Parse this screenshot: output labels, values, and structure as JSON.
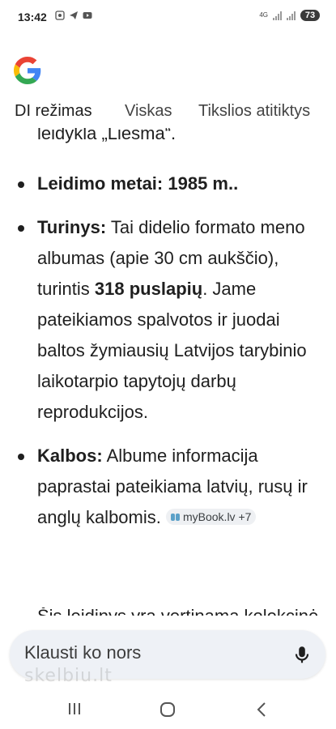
{
  "status_bar": {
    "time": "13:42",
    "network_label": "4G",
    "battery": "73"
  },
  "tabs": [
    {
      "label": "DI režimas",
      "active": true
    },
    {
      "label": "Viskas",
      "active": false
    },
    {
      "label": "Tikslios atitiktys",
      "active": false
    }
  ],
  "content": {
    "partial_top_line": "leidykla „Liesma“.",
    "items": [
      {
        "key": "Leidimo metai:",
        "text": " 1985 m..",
        "key_bold": true
      },
      {
        "key": "Turinys:",
        "segments": [
          {
            "t": " Tai didelio formato meno albumas (apie 30 cm aukščio), turintis ",
            "b": false
          },
          {
            "t": "318 puslapių",
            "b": true
          },
          {
            "t": ". Jame pateikiamos spalvotos ir juodai baltos žymiausių Latvijos tarybinio laikotarpio tapytojų darbų reprodukcijos.",
            "b": false
          }
        ]
      },
      {
        "key": "Kalbos:",
        "text": " Albume informacija paprastai pateikiama latvių, rusų ir anglų kalbomis. ",
        "source_chip": "myBook.lv +7"
      }
    ],
    "partial_bottom_line": "Šis leidinys yra vertinama kolekcinė"
  },
  "ask_bar": {
    "placeholder": "Klausti ko nors"
  },
  "watermark": "skelbiu.lt",
  "colors": {
    "text": "#1f1f1f",
    "ask_bar_bg": "#eef1f6",
    "chip_bg": "#eef0f3",
    "google_blue": "#4285F4",
    "google_red": "#EA4335",
    "google_yellow": "#FBBC05",
    "google_green": "#34A853"
  },
  "icons": {
    "logo": "google-g-logo",
    "mic": "microphone-icon",
    "nav_recent": "recent-apps-icon",
    "nav_home": "home-icon",
    "nav_back": "back-icon"
  }
}
